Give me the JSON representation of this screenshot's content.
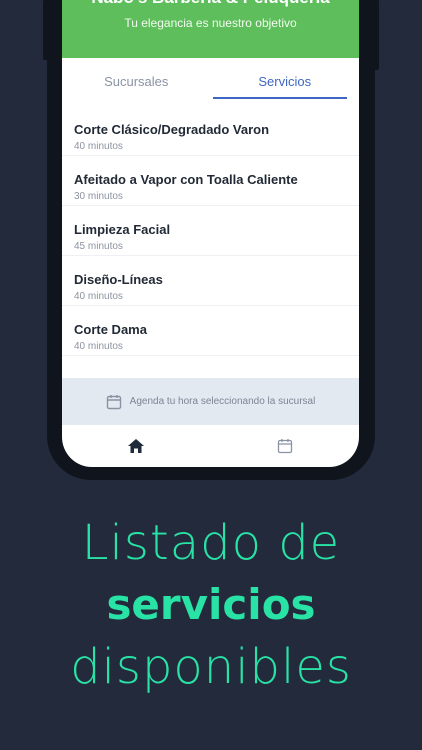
{
  "header": {
    "app_title": "Nabo's Barbería & Peluquería",
    "subtitle": "Tu elegancia es nuestro objetivo"
  },
  "tabs": [
    {
      "label": "Sucursales",
      "active": false
    },
    {
      "label": "Servicios",
      "active": true
    }
  ],
  "services": [
    {
      "name": "Corte Clásico/Degradado Varon",
      "duration": "40 minutos"
    },
    {
      "name": "Afeitado a Vapor con Toalla Caliente",
      "duration": "30 minutos"
    },
    {
      "name": "Limpieza Facial",
      "duration": "45 minutos"
    },
    {
      "name": "Diseño-Líneas",
      "duration": "40 minutos"
    },
    {
      "name": "Corte Dama",
      "duration": "40 minutos"
    }
  ],
  "booking_bar": {
    "icon": "calendar-icon",
    "text": "Agenda tu hora seleccionando la sucursal"
  },
  "bottom_nav": [
    {
      "icon": "home-icon",
      "active": true
    },
    {
      "icon": "calendar-icon",
      "active": false
    }
  ],
  "promo": {
    "line1": "Listado de",
    "line2": "servicios",
    "line3": "disponibles"
  },
  "colors": {
    "background": "#232a3b",
    "header_green": "#5fbe5c",
    "tab_active": "#3f66c4",
    "promo_text": "#29e2a5"
  }
}
